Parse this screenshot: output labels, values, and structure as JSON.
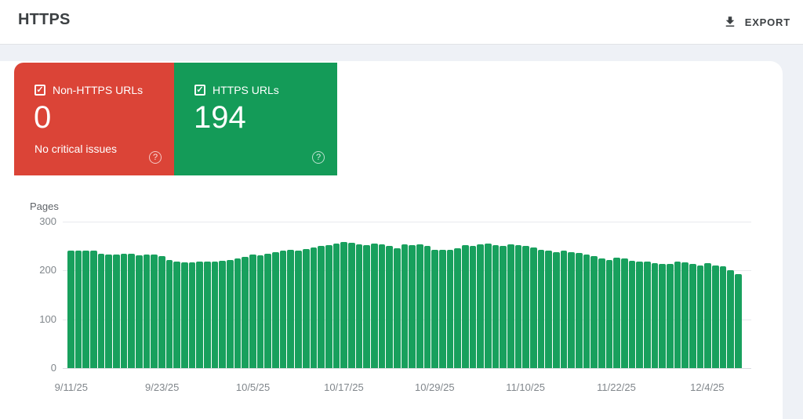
{
  "header": {
    "title": "HTTPS",
    "export_label": "EXPORT"
  },
  "icons": {
    "checkbox_check": "✓",
    "help_glyph": "?"
  },
  "cards": [
    {
      "label": "Non-HTTPS URLs",
      "value": "0",
      "subtext": "No critical issues",
      "color": "#db4437",
      "checked": true
    },
    {
      "label": "HTTPS URLs",
      "value": "194",
      "subtext": "",
      "color": "#149b58",
      "checked": true
    }
  ],
  "chart_data": {
    "type": "bar",
    "title": "",
    "ylabel": "Pages",
    "bar_color": "#18a05d",
    "ylim": [
      0,
      300
    ],
    "yticks": [
      0,
      100,
      200,
      300
    ],
    "grid": true,
    "legend_position": "none",
    "xticks_shown": [
      "9/11/25",
      "9/23/25",
      "10/5/25",
      "10/17/25",
      "10/29/25",
      "11/10/25",
      "11/22/25",
      "12/4/25"
    ],
    "xtick_every_n_bars": 12,
    "x": [
      "9/11/25",
      "9/12/25",
      "9/13/25",
      "9/14/25",
      "9/15/25",
      "9/16/25",
      "9/17/25",
      "9/18/25",
      "9/19/25",
      "9/20/25",
      "9/21/25",
      "9/22/25",
      "9/23/25",
      "9/24/25",
      "9/25/25",
      "9/26/25",
      "9/27/25",
      "9/28/25",
      "9/29/25",
      "9/30/25",
      "10/1/25",
      "10/2/25",
      "10/3/25",
      "10/4/25",
      "10/5/25",
      "10/6/25",
      "10/7/25",
      "10/8/25",
      "10/9/25",
      "10/10/25",
      "10/11/25",
      "10/12/25",
      "10/13/25",
      "10/14/25",
      "10/15/25",
      "10/16/25",
      "10/17/25",
      "10/18/25",
      "10/19/25",
      "10/20/25",
      "10/21/25",
      "10/22/25",
      "10/23/25",
      "10/24/25",
      "10/25/25",
      "10/26/25",
      "10/27/25",
      "10/28/25",
      "10/29/25",
      "10/30/25",
      "10/31/25",
      "11/1/25",
      "11/2/25",
      "11/3/25",
      "11/4/25",
      "11/5/25",
      "11/6/25",
      "11/7/25",
      "11/8/25",
      "11/9/25",
      "11/10/25",
      "11/11/25",
      "11/12/25",
      "11/13/25",
      "11/14/25",
      "11/15/25",
      "11/16/25",
      "11/17/25",
      "11/18/25",
      "11/19/25",
      "11/20/25",
      "11/21/25",
      "11/22/25",
      "11/23/25",
      "11/24/25",
      "11/25/25",
      "11/26/25",
      "11/27/25",
      "11/28/25",
      "11/29/25",
      "11/30/25",
      "12/1/25",
      "12/2/25",
      "12/3/25",
      "12/4/25",
      "12/5/25",
      "12/6/25",
      "12/7/25",
      "12/8/25"
    ],
    "values": [
      241,
      240,
      240,
      241,
      234,
      233,
      233,
      234,
      235,
      231,
      232,
      233,
      230,
      222,
      218,
      216,
      217,
      218,
      219,
      218,
      220,
      222,
      225,
      228,
      232,
      231,
      235,
      238,
      240,
      242,
      241,
      244,
      247,
      250,
      252,
      255,
      258,
      256,
      254,
      252,
      255,
      253,
      250,
      246,
      253,
      252,
      254,
      250,
      243,
      242,
      243,
      245,
      252,
      250,
      253,
      255,
      252,
      250,
      253,
      252,
      250,
      247,
      243,
      240,
      238,
      240,
      238,
      236,
      233,
      230,
      225,
      222,
      226,
      224,
      220,
      218,
      218,
      215,
      214,
      213,
      218,
      216,
      213,
      211,
      215,
      211,
      208,
      201,
      193
    ]
  }
}
